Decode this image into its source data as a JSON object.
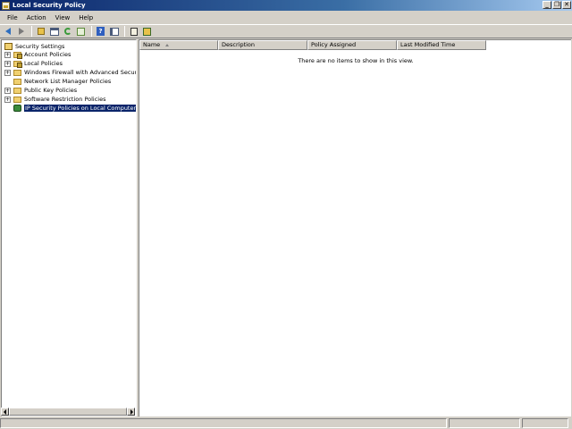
{
  "window": {
    "title": "Local Security Policy",
    "controls": [
      "_",
      "❐",
      "✕"
    ]
  },
  "menu": [
    "File",
    "Action",
    "View",
    "Help"
  ],
  "toolbar": {
    "buttons": [
      "back-icon",
      "forward-icon",
      "up-folder-icon",
      "show-hide-tree-icon",
      "refresh-icon",
      "export-list-icon",
      "help-icon",
      "properties-icon",
      "lock-icon",
      "network-icon"
    ]
  },
  "tree": {
    "root": "Security Settings",
    "items": [
      {
        "label": "Account Policies",
        "expandable": true
      },
      {
        "label": "Local Policies",
        "expandable": true
      },
      {
        "label": "Windows Firewall with Advanced Security",
        "expandable": true
      },
      {
        "label": "Network List Manager Policies",
        "expandable": false
      },
      {
        "label": "Public Key Policies",
        "expandable": true
      },
      {
        "label": "Software Restriction Policies",
        "expandable": true
      },
      {
        "label": "IP Security Policies on Local Computer",
        "expandable": false,
        "selected": true
      }
    ],
    "expander_symbol": "+"
  },
  "list": {
    "columns": [
      "Name",
      "Description",
      "Policy Assigned",
      "Last Modified Time"
    ],
    "sorted_column": "Name",
    "empty_message": "There are no items to show in this view."
  },
  "colors": {
    "selection": "#0a246a",
    "titlebar_start": "#0a246a",
    "face": "#d4d0c8"
  }
}
